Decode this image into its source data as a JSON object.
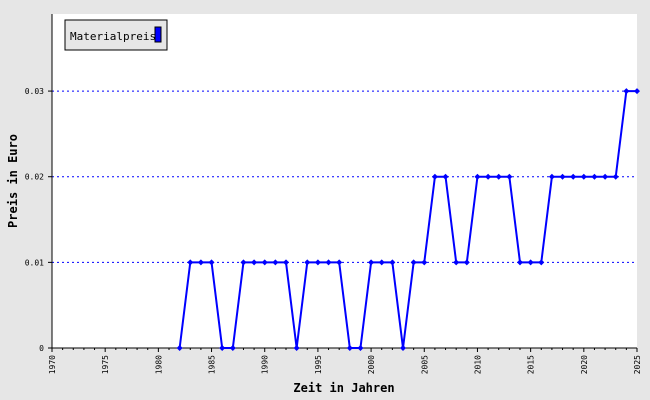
{
  "chart_data": {
    "type": "line",
    "title": "",
    "xlabel": "Zeit in Jahren",
    "ylabel": "Preis in Euro",
    "xlim": [
      1970,
      2025
    ],
    "ylim": [
      0,
      0.039
    ],
    "x_ticks": [
      1970,
      1975,
      1980,
      1985,
      1990,
      1995,
      2000,
      2005,
      2010,
      2015,
      2020,
      2025
    ],
    "y_ticks": [
      0,
      0.01,
      0.02,
      0.03
    ],
    "y_tick_labels": [
      "0",
      "0.01",
      "0.02",
      "0.03"
    ],
    "grid": "horizontal-dotted",
    "legend": {
      "position": "top-left",
      "entries": [
        "Materialpreis"
      ]
    },
    "colors": {
      "series": "#0000ff",
      "grid": "#0000ff",
      "plot_bg": "#ffffff",
      "frame_bg": "#e6e6e6"
    },
    "series": [
      {
        "name": "Materialpreis",
        "x": [
          1982,
          1983,
          1984,
          1985,
          1986,
          1987,
          1988,
          1989,
          1990,
          1991,
          1992,
          1993,
          1994,
          1995,
          1996,
          1997,
          1998,
          1999,
          2000,
          2001,
          2002,
          2003,
          2004,
          2005,
          2006,
          2007,
          2008,
          2009,
          2010,
          2011,
          2012,
          2013,
          2014,
          2015,
          2016,
          2017,
          2018,
          2019,
          2020,
          2021,
          2022,
          2023,
          2024,
          2025
        ],
        "values": [
          0,
          0.01,
          0.01,
          0.01,
          0,
          0,
          0.01,
          0.01,
          0.01,
          0.01,
          0.01,
          0,
          0.01,
          0.01,
          0.01,
          0.01,
          0,
          0,
          0.01,
          0.01,
          0.01,
          0,
          0.01,
          0.01,
          0.02,
          0.02,
          0.01,
          0.01,
          0.02,
          0.02,
          0.02,
          0.02,
          0.01,
          0.01,
          0.01,
          0.02,
          0.02,
          0.02,
          0.02,
          0.02,
          0.02,
          0.02,
          0.03,
          0.03
        ]
      }
    ]
  }
}
